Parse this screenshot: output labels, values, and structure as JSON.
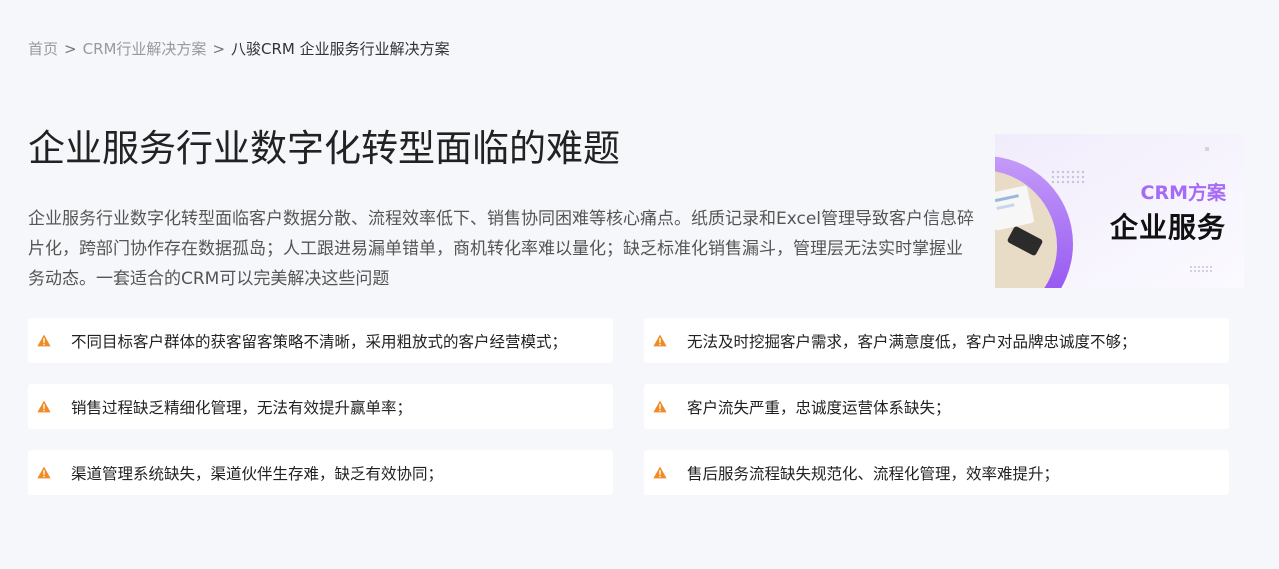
{
  "breadcrumb": {
    "home": "首页",
    "sep": ">",
    "category": "CRM行业解决方案",
    "current": "八骏CRM 企业服务行业解决方案"
  },
  "heading": {
    "title": "企业服务行业数字化转型面临的难题",
    "description": "企业服务行业数字化转型面临客户数据分散、流程效率低下、销售协同困难等核心痛点。纸质记录和Excel管理导致客户信息碎片化，跨部门协作存在数据孤岛；人工跟进易漏单错单，商机转化率难以量化；缺乏标准化销售漏斗，管理层无法实时掌握业务动态。一套适合的CRM可以完美解决这些问题"
  },
  "banner": {
    "line1": "CRM方案",
    "line2": "企业服务"
  },
  "colors": {
    "accent": "#a66bf5",
    "warning": "#f08a24",
    "background": "#f5f7fa"
  },
  "problems": [
    {
      "icon": "warning-icon",
      "text": "不同目标客户群体的获客留客策略不清晰，采用粗放式的客户经营模式；"
    },
    {
      "icon": "warning-icon",
      "text": "无法及时挖掘客户需求，客户满意度低，客户对品牌忠诚度不够；"
    },
    {
      "icon": "warning-icon",
      "text": "销售过程缺乏精细化管理，无法有效提升赢单率；"
    },
    {
      "icon": "warning-icon",
      "text": "客户流失严重，忠诚度运营体系缺失；"
    },
    {
      "icon": "warning-icon",
      "text": "渠道管理系统缺失，渠道伙伴生存难，缺乏有效协同；"
    },
    {
      "icon": "warning-icon",
      "text": "售后服务流程缺失规范化、流程化管理，效率难提升；"
    }
  ]
}
